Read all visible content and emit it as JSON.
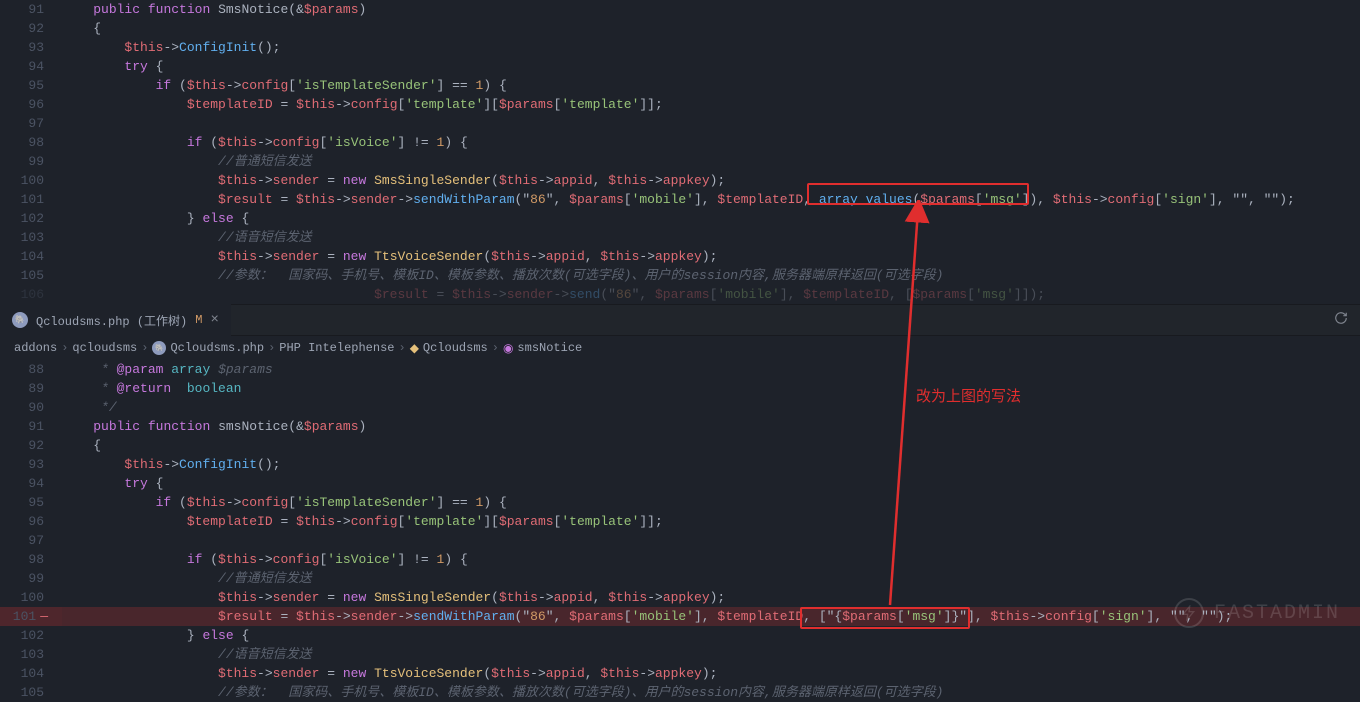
{
  "top_pane_start_line": 91,
  "bottom_pane_start_line": 88,
  "tab": {
    "icon": "php-elephant",
    "filename": "Qcloudsms.php",
    "suffix": "(工作树)",
    "dirty_mark": "M",
    "close_glyph": "×"
  },
  "breadcrumb": {
    "items": [
      {
        "icon": "",
        "label": "addons"
      },
      {
        "icon": "",
        "label": "qcloudsms"
      },
      {
        "icon": "php",
        "label": "Qcloudsms.php"
      },
      {
        "icon": "",
        "label": "PHP Intelephense"
      },
      {
        "icon": "class",
        "label": "Qcloudsms"
      },
      {
        "icon": "method",
        "label": "smsNotice"
      }
    ],
    "sep": "›"
  },
  "top_lines": [
    "    public function SmsNotice(&$params)",
    "    {",
    "        $this->ConfigInit();",
    "        try {",
    "            if ($this->config['isTemplateSender'] == 1) {",
    "                $templateID = $this->config['template'][$params['template']];",
    "",
    "                if ($this->config['isVoice'] != 1) {",
    "                    //普通短信发送",
    "                    $this->sender = new SmsSingleSender($this->appid, $this->appkey);",
    "                    $result = $this->sender->sendWithParam(\"86\", $params['mobile'], $templateID, array_values($params['msg']), $this->config['sign'], \"\", \"\");",
    "                } else {",
    "                    //语音短信发送",
    "                    $this->sender = new TtsVoiceSender($this->appid, $this->appkey);",
    "                    //参数：  国家码、手机号、模板ID、模板参数、播放次数(可选字段)、用户的session内容,服务器端原样返回(可选字段)",
    "                    $result = $this->sender->send(\"86\", $params['mobile'], $templateID, [$params['msg']]);"
  ],
  "bottom_lines": [
    "     * @param array $params",
    "     * @return  boolean",
    "     */",
    "    public function smsNotice(&$params)",
    "    {",
    "        $this->ConfigInit();",
    "        try {",
    "            if ($this->config['isTemplateSender'] == 1) {",
    "                $templateID = $this->config['template'][$params['template']];",
    "",
    "                if ($this->config['isVoice'] != 1) {",
    "                    //普通短信发送",
    "                    $this->sender = new SmsSingleSender($this->appid, $this->appkey);",
    "                    $result = $this->sender->sendWithParam(\"86\", $params['mobile'], $templateID, [\"{$params['msg']}\"], $this->config['sign'], \"\", \"\");",
    "                } else {",
    "                    //语音短信发送",
    "                    $this->sender = new TtsVoiceSender($this->appid, $this->appkey);",
    "                    //参数：  国家码、手机号、模板ID、模板参数、播放次数(可选字段)、用户的session内容,服务器端原样返回(可选字段)"
  ],
  "annotation": {
    "text": "改为上图的写法"
  },
  "watermark_text": "FASTADMIN",
  "colors": {
    "bg": "#1e222a",
    "accent_red": "#e02e2e"
  }
}
